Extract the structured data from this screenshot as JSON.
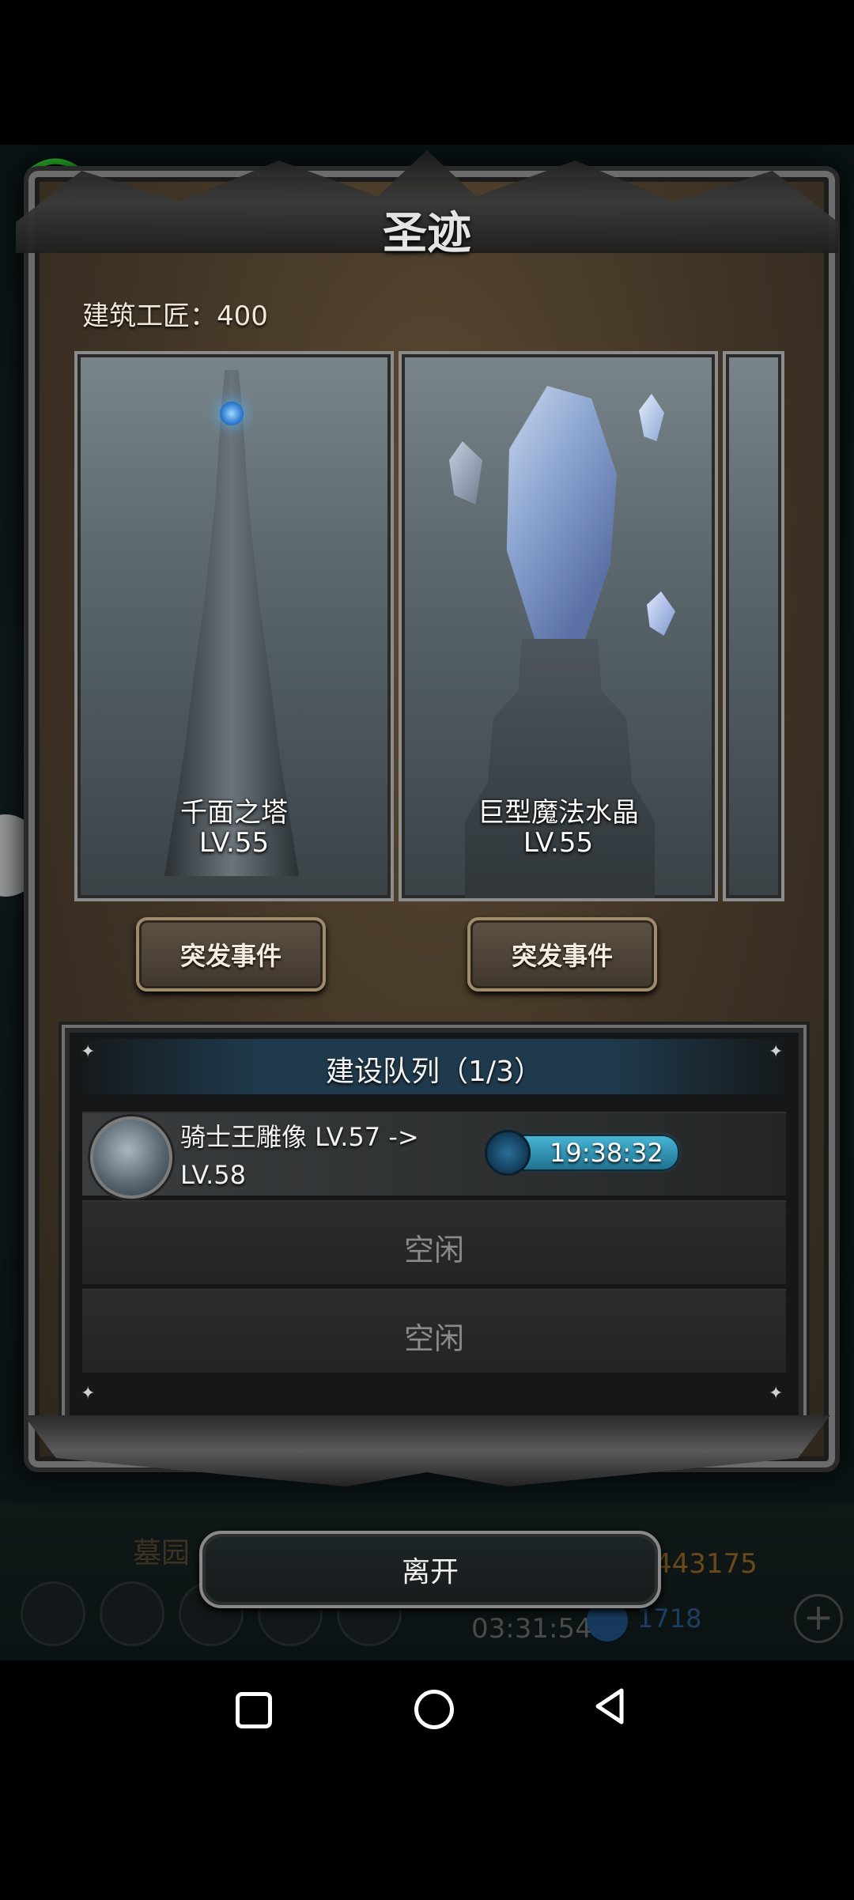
{
  "dialog": {
    "title": "圣迹",
    "craftsman": "建筑工匠：400"
  },
  "buildings": [
    {
      "name": "千面之塔",
      "level": "LV.55",
      "event_label": "突发事件"
    },
    {
      "name": "巨型魔法水晶",
      "level": "LV.55",
      "event_label": "突发事件"
    }
  ],
  "queue": {
    "title": "建设队列（1/3）",
    "rows": [
      {
        "line1": "骑士王雕像 LV.57 ->",
        "line2": "LV.58",
        "timer": "19:38:32"
      },
      {
        "idle": "空闲"
      },
      {
        "idle": "空闲"
      }
    ]
  },
  "leave_label": "离开",
  "background": {
    "location": "墓园",
    "gold": "443175",
    "time": "03:31:54",
    "gems": "1718"
  },
  "colors": {
    "accent_gold": "#a08c6c",
    "timer_blue": "#49b8d8",
    "panel_dark": "#151718"
  }
}
